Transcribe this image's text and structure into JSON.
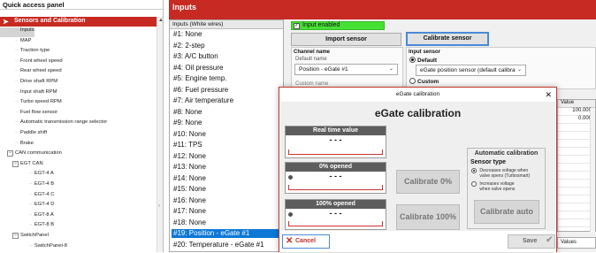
{
  "quick_access": {
    "title": "Quick access panel",
    "selected": "Sensors and Calibration",
    "tree": [
      {
        "label": "Inputs",
        "level": 1,
        "hl": true
      },
      {
        "label": "MAP",
        "level": 1
      },
      {
        "label": "Traction type",
        "level": 1
      },
      {
        "label": "Front wheel speed",
        "level": 1
      },
      {
        "label": "Rear wheel speed",
        "level": 1
      },
      {
        "label": "Drive shaft RPM",
        "level": 1
      },
      {
        "label": "Input shaft RPM",
        "level": 1
      },
      {
        "label": "Turbo speed RPM",
        "level": 1
      },
      {
        "label": "Fuel flow sensor",
        "level": 1
      },
      {
        "label": "Automatic transmission range selector",
        "level": 1
      },
      {
        "label": "Paddle shift",
        "level": 1
      },
      {
        "label": "Brake",
        "level": 1
      },
      {
        "label": "CAN communication",
        "level": 1,
        "expander": "−"
      },
      {
        "label": "EGT CAN",
        "level": 2,
        "expander": "−"
      },
      {
        "label": "EGT-4 A",
        "level": 3
      },
      {
        "label": "EGT-4 B",
        "level": 3
      },
      {
        "label": "EGT-4 C",
        "level": 3
      },
      {
        "label": "EGT-4 D",
        "level": 3
      },
      {
        "label": "EGT-8 A",
        "level": 3
      },
      {
        "label": "EGT-8 B",
        "level": 3
      },
      {
        "label": "SwitchPanel",
        "level": 2,
        "expander": "−"
      },
      {
        "label": "SwitchPanel-8",
        "level": 3
      }
    ]
  },
  "inputs": {
    "header": "Inputs",
    "list_title": "Inputs (White wires)",
    "items": [
      "#1: None",
      "#2: 2-step",
      "#3: A/C button",
      "#4: Oil pressure",
      "#5: Engine temp.",
      "#6: Fuel pressure",
      "#7: Air temperature",
      "#8: None",
      "#9: None",
      "#10: None",
      "#11: TPS",
      "#12: None",
      "#13: None",
      "#14: None",
      "#15: None",
      "#16: None",
      "#17: None",
      "#18: None",
      "#19: Position - eGate #1",
      "#20: Temperature - eGate #1"
    ],
    "selected_index": 18,
    "enabled_label": "Input enabled",
    "import_btn": "Import sensor",
    "calibrate_btn": "Calibrate sensor",
    "channel_name_label": "Channel name",
    "default_name_label": "Default name",
    "default_name_value": "Position - eGate #1",
    "custom_name_label": "Custom name",
    "input_sensor_label": "Input sensor",
    "default_radio": "Default",
    "sensor_value": "eGate position sensor (default calibra",
    "custom_radio": "Custom",
    "table_header": "Value",
    "table_values": [
      "100.000",
      "0.000"
    ],
    "bottom_field": "Values"
  },
  "dialog": {
    "window_title": "eGate calibration",
    "heading": "eGate calibration",
    "realtime_label": "Real time value",
    "realtime_value": "- - -",
    "opened0_label": "0% opened",
    "opened0_value": "- - -",
    "opened100_label": "100% opened",
    "opened100_value": "- - -",
    "cal0_btn": "Calibrate 0%",
    "cal100_btn": "Calibrate 100%",
    "auto_title": "Automatic calibration",
    "sensor_type": "Sensor type",
    "opt_decrease": [
      "Decreases voltage when",
      "valve opens (Turbosmart)"
    ],
    "opt_increase": [
      "Increases voltage",
      "when valve opens"
    ],
    "cal_auto_btn": "Calibrate auto",
    "cancel_btn": "Cancel",
    "save_btn": "Save"
  }
}
